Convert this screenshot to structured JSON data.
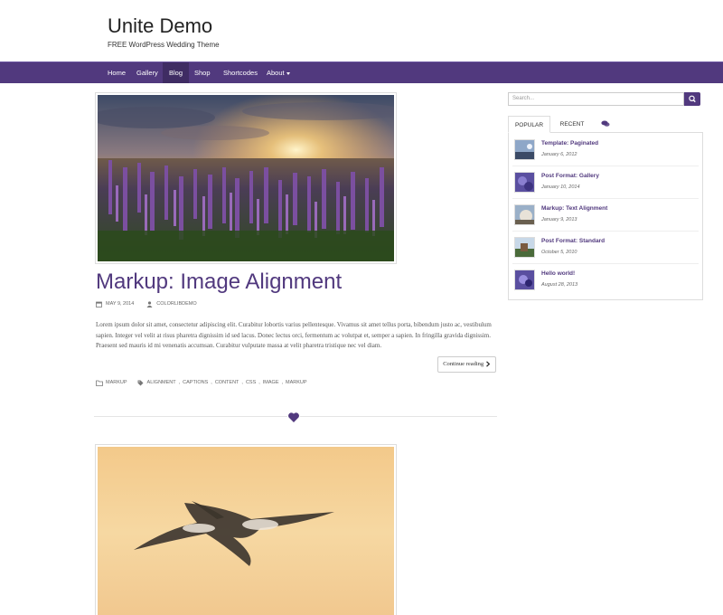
{
  "site": {
    "title": "Unite Demo",
    "description": "FREE WordPress Wedding Theme"
  },
  "nav": {
    "items": [
      "Home",
      "Gallery",
      "Blog",
      "Shop",
      "Shortcodes",
      "About"
    ],
    "active": "Blog"
  },
  "post": {
    "title": "Markup: Image Alignment",
    "date": "MAY 9, 2014",
    "author": "COLORLIBDEMO",
    "excerpt": "Lorem ipsum dolor sit amet, consectetur adipiscing elit. Curabitur lobortis varius pellentesque. Vivamus sit amet tellus porta, bibendum justo ac, vestibulum sapien. Integer vel velit at risus pharetra dignissim id sed lacus. Donec lectus orci, fermentum ac volutpat et, semper a sapien. In fringilla gravida dignissim. Praesent sed mauris id mi venenatis accumsan. Curabitur vulputate massa at velit pharetra tristique nec vel diam.",
    "continue_label": "Continue reading",
    "category": "MARKUP",
    "tags": [
      "ALIGNMENT",
      "CAPTIONS",
      "CONTENT",
      "CSS",
      "IMAGE",
      "MARKUP"
    ]
  },
  "sidebar": {
    "search_placeholder": "Search...",
    "tabs": [
      "POPULAR",
      "RECENT"
    ],
    "items": [
      {
        "title": "Template: Paginated",
        "date": "January 6, 2012"
      },
      {
        "title": "Post Format: Gallery",
        "date": "January 10, 2014"
      },
      {
        "title": "Markup: Text Alignment",
        "date": "January 9, 2013"
      },
      {
        "title": "Post Format: Standard",
        "date": "October 5, 2010"
      },
      {
        "title": "Hello world!",
        "date": "August 28, 2013"
      }
    ]
  },
  "colors": {
    "brand": "#51397e",
    "nav_active": "#3f2c63"
  },
  "icons": [
    "search-icon",
    "calendar-icon",
    "user-icon",
    "folder-icon",
    "tags-icon",
    "chevron-right-icon",
    "comments-icon",
    "heart-icon"
  ]
}
